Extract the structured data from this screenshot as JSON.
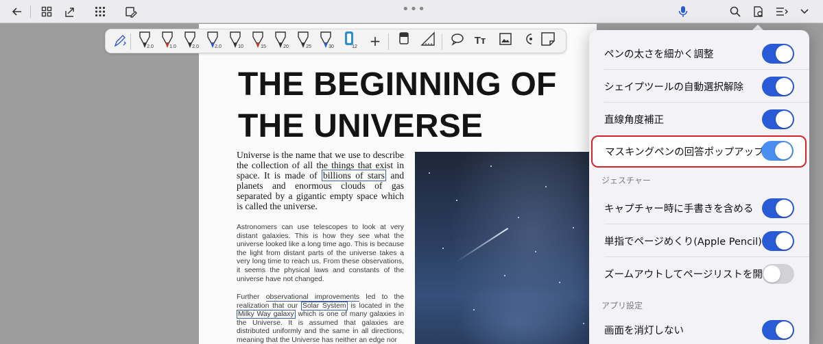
{
  "topbar": {
    "icons": [
      "back-arrow-icon",
      "grid-icon",
      "share-icon",
      "apps-icon",
      "edit-doc-icon",
      "more-dots-icon",
      "mic-icon",
      "search-icon",
      "settings-doc-icon",
      "list-icon",
      "chevron-down-icon"
    ],
    "more_dots": "•••"
  },
  "pen_toolbar": {
    "tools": [
      {
        "name": "pen",
        "size": "2.0",
        "color": "#333333"
      },
      {
        "name": "pen",
        "size": "1.0",
        "color": "#c0392b"
      },
      {
        "name": "pen",
        "size": "2.0",
        "color": "#333333"
      },
      {
        "name": "pen",
        "size": "2.0",
        "color": "#2c5bd0"
      },
      {
        "name": "highlighter",
        "size": "10",
        "color": "#333333"
      },
      {
        "name": "highlighter",
        "size": "15",
        "color": "#c0392b"
      },
      {
        "name": "highlighter",
        "size": "20",
        "color": "#333333"
      },
      {
        "name": "highlighter",
        "size": "25",
        "color": "#333333"
      },
      {
        "name": "highlighter",
        "size": "30",
        "color": "#2c5bd0"
      },
      {
        "name": "tape",
        "size": "12",
        "color": "#2c8fd6"
      }
    ],
    "add": "+",
    "text_tool": "Tт"
  },
  "document": {
    "title": "THE BEGINNING OF THE UNIVERSE",
    "intro": {
      "before": "Universe is the name that we use to describe the collection of all the things that exist in space. It is made of ",
      "highlight": "billions of stars",
      "after": " and planets and enormous clouds of gas separated by a gigantic empty space which is called the universe."
    },
    "para1": "Astronomers can use telescopes to look at very distant galaxies. This is how they see what the universe looked like a long time ago. This is because the light from distant parts of the universe takes a very long time to reach us. From these observations, it seems the physical laws and constants of the universe have not changed.",
    "para2": {
      "a": "Further ",
      "b": "observational improvements",
      "c": " led to the realization that our ",
      "d": "Solar System",
      "e": " is located in the ",
      "f": "Milky Way galaxy",
      "g": " which is one of many galaxies in the Universe. It is assumed that galaxies are distributed uniformly and the same in all directions, meaning that the Universe has neither an edge nor"
    }
  },
  "settings": {
    "rows": [
      {
        "label": "ペンの太さを細かく調整",
        "on": true
      },
      {
        "label": "シェイプツールの自動選択解除",
        "on": true
      },
      {
        "label": "直線角度補正",
        "on": true
      },
      {
        "label": "マスキングペンの回答ポップアップ",
        "on": true
      },
      {
        "label": "キャプチャー時に手書きを含める",
        "on": true
      },
      {
        "label": "単指でページめくり(Apple Pencil)",
        "on": true
      },
      {
        "label": "ズームアウトしてページリストを開く",
        "on": false
      },
      {
        "label": "画面を消灯しない",
        "on": true
      }
    ],
    "section_gesture": "ジェスチャー",
    "section_app": "アプリ設定"
  },
  "colors": {
    "accent": "#2a5bd7",
    "highlight_border": "#d5232c"
  }
}
